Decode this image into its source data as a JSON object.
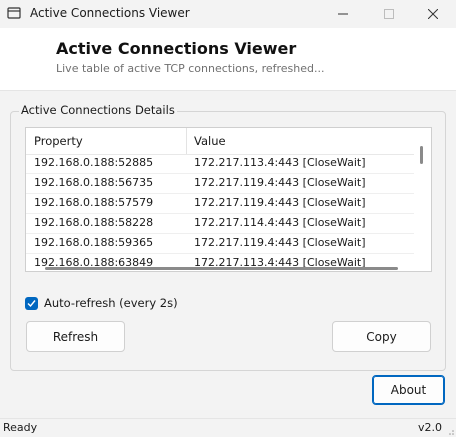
{
  "window": {
    "title": "Active Connections Viewer"
  },
  "header": {
    "title": "Active Connections Viewer",
    "subtitle": "Live table of active TCP connections, refreshed..."
  },
  "group": {
    "label": "Active Connections Details"
  },
  "table": {
    "columns": [
      "Property",
      "Value"
    ],
    "rows": [
      {
        "property": "192.168.0.188:52885",
        "value": "172.217.113.4:443  [CloseWait]"
      },
      {
        "property": "192.168.0.188:56735",
        "value": "172.217.119.4:443  [CloseWait]"
      },
      {
        "property": "192.168.0.188:57579",
        "value": "172.217.119.4:443  [CloseWait]"
      },
      {
        "property": "192.168.0.188:58228",
        "value": "172.217.114.4:443  [CloseWait]"
      },
      {
        "property": "192.168.0.188:59365",
        "value": "172.217.119.4:443  [CloseWait]"
      },
      {
        "property": "192.168.0.188:63849",
        "value": "172.217.113.4:443  [CloseWait]"
      }
    ]
  },
  "auto_refresh": {
    "label": "Auto-refresh (every 2s)",
    "checked": true
  },
  "buttons": {
    "refresh": "Refresh",
    "copy": "Copy",
    "about": "About"
  },
  "status": {
    "text": "Ready",
    "version": "v2.0"
  },
  "colors": {
    "accent": "#0067c0",
    "window_bg": "#f3f3f3"
  }
}
